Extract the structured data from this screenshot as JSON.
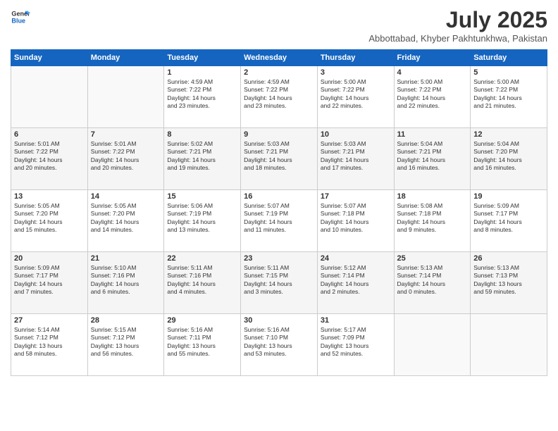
{
  "header": {
    "logo_line1": "General",
    "logo_line2": "Blue",
    "month_year": "July 2025",
    "location": "Abbottabad, Khyber Pakhtunkhwa, Pakistan"
  },
  "days_of_week": [
    "Sunday",
    "Monday",
    "Tuesday",
    "Wednesday",
    "Thursday",
    "Friday",
    "Saturday"
  ],
  "weeks": [
    [
      {
        "day": "",
        "info": ""
      },
      {
        "day": "",
        "info": ""
      },
      {
        "day": "1",
        "info": "Sunrise: 4:59 AM\nSunset: 7:22 PM\nDaylight: 14 hours\nand 23 minutes."
      },
      {
        "day": "2",
        "info": "Sunrise: 4:59 AM\nSunset: 7:22 PM\nDaylight: 14 hours\nand 23 minutes."
      },
      {
        "day": "3",
        "info": "Sunrise: 5:00 AM\nSunset: 7:22 PM\nDaylight: 14 hours\nand 22 minutes."
      },
      {
        "day": "4",
        "info": "Sunrise: 5:00 AM\nSunset: 7:22 PM\nDaylight: 14 hours\nand 22 minutes."
      },
      {
        "day": "5",
        "info": "Sunrise: 5:00 AM\nSunset: 7:22 PM\nDaylight: 14 hours\nand 21 minutes."
      }
    ],
    [
      {
        "day": "6",
        "info": "Sunrise: 5:01 AM\nSunset: 7:22 PM\nDaylight: 14 hours\nand 20 minutes."
      },
      {
        "day": "7",
        "info": "Sunrise: 5:01 AM\nSunset: 7:22 PM\nDaylight: 14 hours\nand 20 minutes."
      },
      {
        "day": "8",
        "info": "Sunrise: 5:02 AM\nSunset: 7:21 PM\nDaylight: 14 hours\nand 19 minutes."
      },
      {
        "day": "9",
        "info": "Sunrise: 5:03 AM\nSunset: 7:21 PM\nDaylight: 14 hours\nand 18 minutes."
      },
      {
        "day": "10",
        "info": "Sunrise: 5:03 AM\nSunset: 7:21 PM\nDaylight: 14 hours\nand 17 minutes."
      },
      {
        "day": "11",
        "info": "Sunrise: 5:04 AM\nSunset: 7:21 PM\nDaylight: 14 hours\nand 16 minutes."
      },
      {
        "day": "12",
        "info": "Sunrise: 5:04 AM\nSunset: 7:20 PM\nDaylight: 14 hours\nand 16 minutes."
      }
    ],
    [
      {
        "day": "13",
        "info": "Sunrise: 5:05 AM\nSunset: 7:20 PM\nDaylight: 14 hours\nand 15 minutes."
      },
      {
        "day": "14",
        "info": "Sunrise: 5:05 AM\nSunset: 7:20 PM\nDaylight: 14 hours\nand 14 minutes."
      },
      {
        "day": "15",
        "info": "Sunrise: 5:06 AM\nSunset: 7:19 PM\nDaylight: 14 hours\nand 13 minutes."
      },
      {
        "day": "16",
        "info": "Sunrise: 5:07 AM\nSunset: 7:19 PM\nDaylight: 14 hours\nand 11 minutes."
      },
      {
        "day": "17",
        "info": "Sunrise: 5:07 AM\nSunset: 7:18 PM\nDaylight: 14 hours\nand 10 minutes."
      },
      {
        "day": "18",
        "info": "Sunrise: 5:08 AM\nSunset: 7:18 PM\nDaylight: 14 hours\nand 9 minutes."
      },
      {
        "day": "19",
        "info": "Sunrise: 5:09 AM\nSunset: 7:17 PM\nDaylight: 14 hours\nand 8 minutes."
      }
    ],
    [
      {
        "day": "20",
        "info": "Sunrise: 5:09 AM\nSunset: 7:17 PM\nDaylight: 14 hours\nand 7 minutes."
      },
      {
        "day": "21",
        "info": "Sunrise: 5:10 AM\nSunset: 7:16 PM\nDaylight: 14 hours\nand 6 minutes."
      },
      {
        "day": "22",
        "info": "Sunrise: 5:11 AM\nSunset: 7:16 PM\nDaylight: 14 hours\nand 4 minutes."
      },
      {
        "day": "23",
        "info": "Sunrise: 5:11 AM\nSunset: 7:15 PM\nDaylight: 14 hours\nand 3 minutes."
      },
      {
        "day": "24",
        "info": "Sunrise: 5:12 AM\nSunset: 7:14 PM\nDaylight: 14 hours\nand 2 minutes."
      },
      {
        "day": "25",
        "info": "Sunrise: 5:13 AM\nSunset: 7:14 PM\nDaylight: 14 hours\nand 0 minutes."
      },
      {
        "day": "26",
        "info": "Sunrise: 5:13 AM\nSunset: 7:13 PM\nDaylight: 13 hours\nand 59 minutes."
      }
    ],
    [
      {
        "day": "27",
        "info": "Sunrise: 5:14 AM\nSunset: 7:12 PM\nDaylight: 13 hours\nand 58 minutes."
      },
      {
        "day": "28",
        "info": "Sunrise: 5:15 AM\nSunset: 7:12 PM\nDaylight: 13 hours\nand 56 minutes."
      },
      {
        "day": "29",
        "info": "Sunrise: 5:16 AM\nSunset: 7:11 PM\nDaylight: 13 hours\nand 55 minutes."
      },
      {
        "day": "30",
        "info": "Sunrise: 5:16 AM\nSunset: 7:10 PM\nDaylight: 13 hours\nand 53 minutes."
      },
      {
        "day": "31",
        "info": "Sunrise: 5:17 AM\nSunset: 7:09 PM\nDaylight: 13 hours\nand 52 minutes."
      },
      {
        "day": "",
        "info": ""
      },
      {
        "day": "",
        "info": ""
      }
    ]
  ]
}
